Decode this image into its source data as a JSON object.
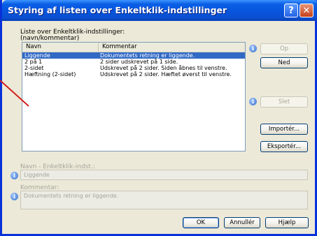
{
  "window": {
    "title": "Styring af listen over Enkeltklik-indstillinger",
    "help_glyph": "?",
    "close_glyph": "✕"
  },
  "list": {
    "caption_line1": "Liste over Enkeltklik-indstillinger:",
    "caption_line2": "(navn/kommentar)",
    "columns": [
      "Navn",
      "Kommentar"
    ],
    "rows": [
      {
        "name": "Liggende",
        "comment": "Dokumentets retning er liggende."
      },
      {
        "name": "2 på 1",
        "comment": "2 sider udskrevet på 1 side."
      },
      {
        "name": "2-sidet",
        "comment": "Udskrevet på 2 sider. Siden åbnes til venstre."
      },
      {
        "name": "Hæftning (2-sidet)",
        "comment": "Udskrevet på 2 sider. Hæftet øverst til venstre."
      }
    ],
    "selected_index": 0
  },
  "side_buttons": {
    "up": "Op",
    "down": "Ned",
    "delete": "Slet",
    "import": "Importér...",
    "export": "Eksportér..."
  },
  "form": {
    "name_label": "Navn - Enkeltklik-indst.:",
    "name_value": "Liggende",
    "comment_label": "Kommentar:",
    "comment_value": "Dokumentets retning er liggende."
  },
  "footer": {
    "ok": "OK",
    "cancel": "Annullér",
    "help": "Hjælp"
  },
  "icons": {
    "info": "info-icon"
  },
  "colors": {
    "titlebar": "#0855dd",
    "selection": "#316ac5",
    "annotation_arrow": "#d42020"
  }
}
